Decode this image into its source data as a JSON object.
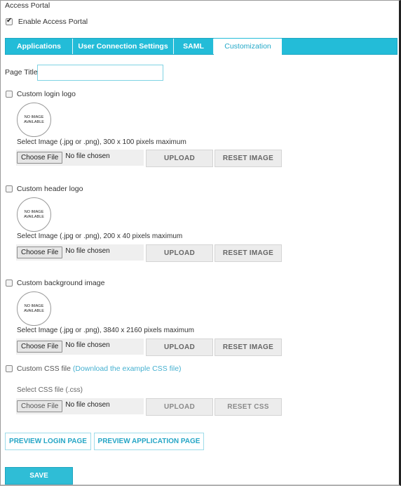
{
  "section_title": "Access Portal",
  "enable_portal": {
    "label": "Enable Access Portal",
    "checked": true
  },
  "tabs": [
    {
      "label": "Applications",
      "active": false
    },
    {
      "label": "User Connection Settings",
      "active": false
    },
    {
      "label": "SAML",
      "active": false
    },
    {
      "label": "Customization",
      "active": true
    }
  ],
  "page_title": {
    "label": "Page Title",
    "value": ""
  },
  "no_image_text": {
    "line1": "NO IMAGE",
    "line2": "AVAILABLE"
  },
  "file_input": {
    "button_label": "Choose File",
    "status": "No file chosen"
  },
  "sections": [
    {
      "checkbox_label": "Custom login logo",
      "checked": false,
      "hint": "Select Image (.jpg or .png), 300 x 100 pixels maximum",
      "upload_label": "UPLOAD",
      "reset_label": "RESET IMAGE"
    },
    {
      "checkbox_label": "Custom header logo",
      "checked": false,
      "hint": "Select Image (.jpg or .png), 200 x 40 pixels maximum",
      "upload_label": "UPLOAD",
      "reset_label": "RESET IMAGE"
    },
    {
      "checkbox_label": "Custom background image",
      "checked": false,
      "hint": "Select Image (.jpg or .png), 3840 x 2160 pixels maximum",
      "upload_label": "UPLOAD",
      "reset_label": "RESET IMAGE"
    },
    {
      "checkbox_label": "Custom CSS file",
      "link_label": "(Download the example CSS file)",
      "checked": false,
      "hint": "Select CSS file (.css)",
      "upload_label": "UPLOAD",
      "reset_label": "RESET CSS"
    }
  ],
  "preview_login_label": "PREVIEW LOGIN PAGE",
  "preview_app_label": "PREVIEW APPLICATION PAGE",
  "save_label": "SAVE",
  "colors": {
    "accent": "#23bcd8",
    "link": "#45b0d0",
    "button_gray": "#ececec"
  }
}
